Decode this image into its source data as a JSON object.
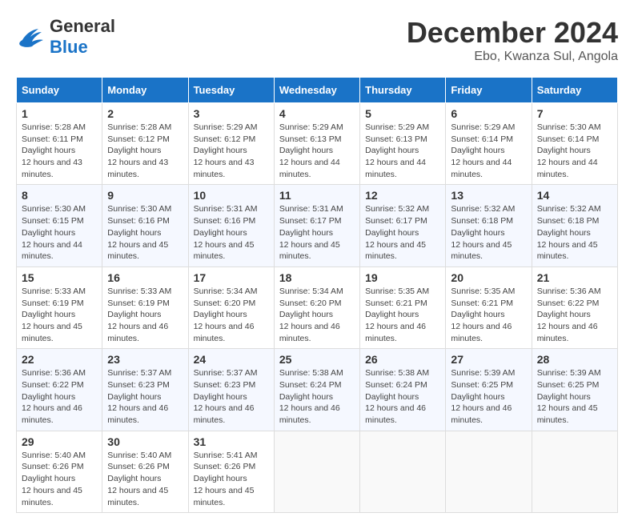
{
  "header": {
    "logo_general": "General",
    "logo_blue": "Blue",
    "month": "December 2024",
    "location": "Ebo, Kwanza Sul, Angola"
  },
  "weekdays": [
    "Sunday",
    "Monday",
    "Tuesday",
    "Wednesday",
    "Thursday",
    "Friday",
    "Saturday"
  ],
  "weeks": [
    [
      {
        "day": "1",
        "sunrise": "5:28 AM",
        "sunset": "6:11 PM",
        "daylight": "12 hours and 43 minutes."
      },
      {
        "day": "2",
        "sunrise": "5:28 AM",
        "sunset": "6:12 PM",
        "daylight": "12 hours and 43 minutes."
      },
      {
        "day": "3",
        "sunrise": "5:29 AM",
        "sunset": "6:12 PM",
        "daylight": "12 hours and 43 minutes."
      },
      {
        "day": "4",
        "sunrise": "5:29 AM",
        "sunset": "6:13 PM",
        "daylight": "12 hours and 44 minutes."
      },
      {
        "day": "5",
        "sunrise": "5:29 AM",
        "sunset": "6:13 PM",
        "daylight": "12 hours and 44 minutes."
      },
      {
        "day": "6",
        "sunrise": "5:29 AM",
        "sunset": "6:14 PM",
        "daylight": "12 hours and 44 minutes."
      },
      {
        "day": "7",
        "sunrise": "5:30 AM",
        "sunset": "6:14 PM",
        "daylight": "12 hours and 44 minutes."
      }
    ],
    [
      {
        "day": "8",
        "sunrise": "5:30 AM",
        "sunset": "6:15 PM",
        "daylight": "12 hours and 44 minutes."
      },
      {
        "day": "9",
        "sunrise": "5:30 AM",
        "sunset": "6:16 PM",
        "daylight": "12 hours and 45 minutes."
      },
      {
        "day": "10",
        "sunrise": "5:31 AM",
        "sunset": "6:16 PM",
        "daylight": "12 hours and 45 minutes."
      },
      {
        "day": "11",
        "sunrise": "5:31 AM",
        "sunset": "6:17 PM",
        "daylight": "12 hours and 45 minutes."
      },
      {
        "day": "12",
        "sunrise": "5:32 AM",
        "sunset": "6:17 PM",
        "daylight": "12 hours and 45 minutes."
      },
      {
        "day": "13",
        "sunrise": "5:32 AM",
        "sunset": "6:18 PM",
        "daylight": "12 hours and 45 minutes."
      },
      {
        "day": "14",
        "sunrise": "5:32 AM",
        "sunset": "6:18 PM",
        "daylight": "12 hours and 45 minutes."
      }
    ],
    [
      {
        "day": "15",
        "sunrise": "5:33 AM",
        "sunset": "6:19 PM",
        "daylight": "12 hours and 45 minutes."
      },
      {
        "day": "16",
        "sunrise": "5:33 AM",
        "sunset": "6:19 PM",
        "daylight": "12 hours and 46 minutes."
      },
      {
        "day": "17",
        "sunrise": "5:34 AM",
        "sunset": "6:20 PM",
        "daylight": "12 hours and 46 minutes."
      },
      {
        "day": "18",
        "sunrise": "5:34 AM",
        "sunset": "6:20 PM",
        "daylight": "12 hours and 46 minutes."
      },
      {
        "day": "19",
        "sunrise": "5:35 AM",
        "sunset": "6:21 PM",
        "daylight": "12 hours and 46 minutes."
      },
      {
        "day": "20",
        "sunrise": "5:35 AM",
        "sunset": "6:21 PM",
        "daylight": "12 hours and 46 minutes."
      },
      {
        "day": "21",
        "sunrise": "5:36 AM",
        "sunset": "6:22 PM",
        "daylight": "12 hours and 46 minutes."
      }
    ],
    [
      {
        "day": "22",
        "sunrise": "5:36 AM",
        "sunset": "6:22 PM",
        "daylight": "12 hours and 46 minutes."
      },
      {
        "day": "23",
        "sunrise": "5:37 AM",
        "sunset": "6:23 PM",
        "daylight": "12 hours and 46 minutes."
      },
      {
        "day": "24",
        "sunrise": "5:37 AM",
        "sunset": "6:23 PM",
        "daylight": "12 hours and 46 minutes."
      },
      {
        "day": "25",
        "sunrise": "5:38 AM",
        "sunset": "6:24 PM",
        "daylight": "12 hours and 46 minutes."
      },
      {
        "day": "26",
        "sunrise": "5:38 AM",
        "sunset": "6:24 PM",
        "daylight": "12 hours and 46 minutes."
      },
      {
        "day": "27",
        "sunrise": "5:39 AM",
        "sunset": "6:25 PM",
        "daylight": "12 hours and 46 minutes."
      },
      {
        "day": "28",
        "sunrise": "5:39 AM",
        "sunset": "6:25 PM",
        "daylight": "12 hours and 45 minutes."
      }
    ],
    [
      {
        "day": "29",
        "sunrise": "5:40 AM",
        "sunset": "6:26 PM",
        "daylight": "12 hours and 45 minutes."
      },
      {
        "day": "30",
        "sunrise": "5:40 AM",
        "sunset": "6:26 PM",
        "daylight": "12 hours and 45 minutes."
      },
      {
        "day": "31",
        "sunrise": "5:41 AM",
        "sunset": "6:26 PM",
        "daylight": "12 hours and 45 minutes."
      },
      null,
      null,
      null,
      null
    ]
  ]
}
